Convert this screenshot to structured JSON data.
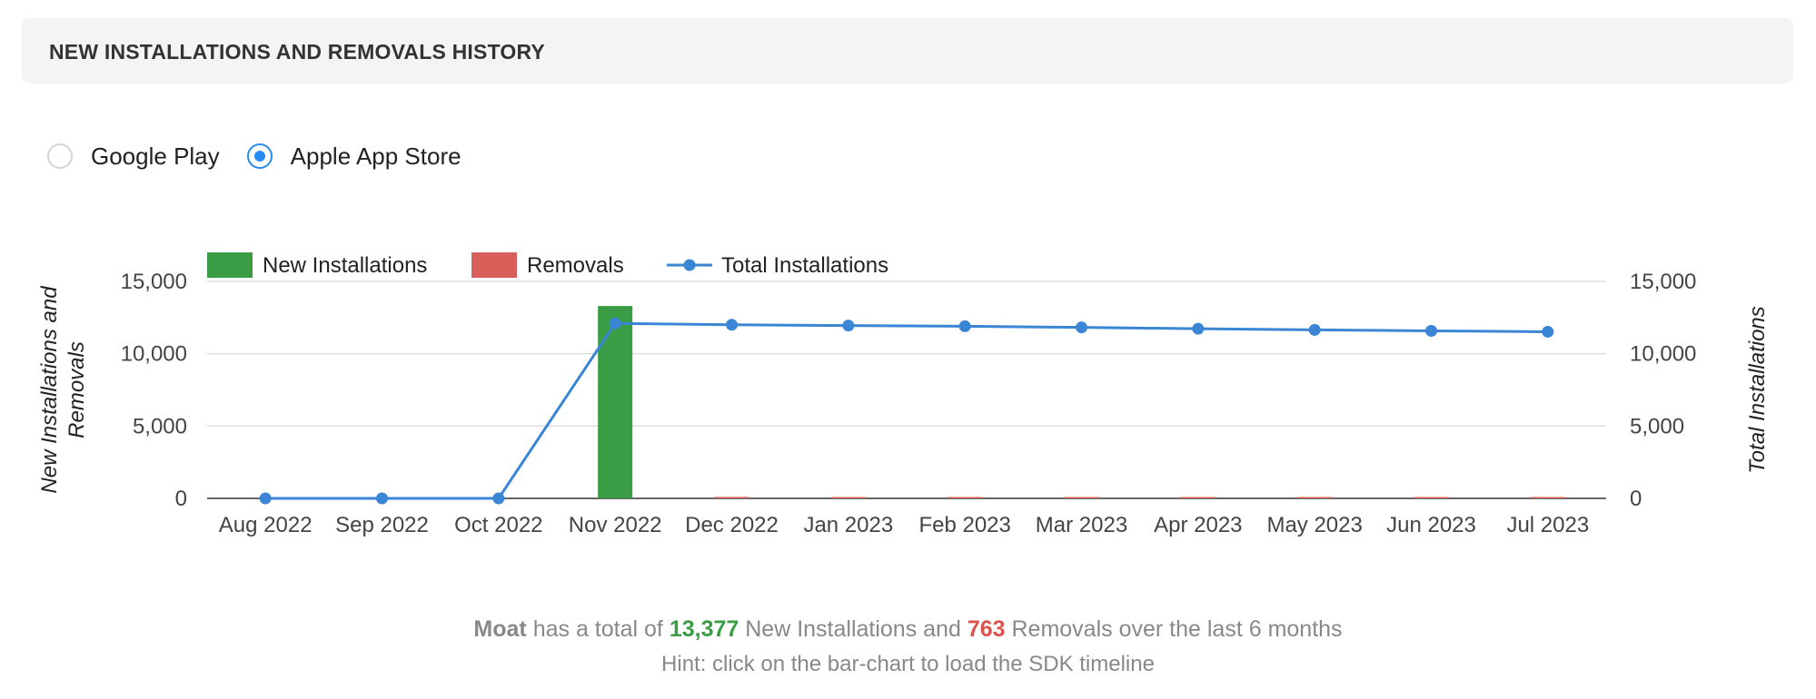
{
  "header": {
    "title": "NEW INSTALLATIONS AND REMOVALS HISTORY"
  },
  "store_selector": {
    "options": [
      {
        "label": "Google Play",
        "selected": false
      },
      {
        "label": "Apple App Store",
        "selected": true
      }
    ]
  },
  "chart_data": {
    "type": "bar",
    "categories": [
      "Aug 2022",
      "Sep 2022",
      "Oct 2022",
      "Nov 2022",
      "Dec 2022",
      "Jan 2023",
      "Feb 2023",
      "Mar 2023",
      "Apr 2023",
      "May 2023",
      "Jun 2023",
      "Jul 2023"
    ],
    "series": [
      {
        "name": "New Installations",
        "type": "bar",
        "axis": "left",
        "color": "#3a9c45",
        "values": [
          0,
          0,
          0,
          13300,
          0,
          0,
          0,
          0,
          0,
          0,
          0,
          0
        ]
      },
      {
        "name": "Removals",
        "type": "bar",
        "axis": "left",
        "color": "#d9605a",
        "values": [
          0,
          0,
          0,
          0,
          100,
          40,
          40,
          40,
          80,
          40,
          80,
          40
        ]
      },
      {
        "name": "Total Installations",
        "type": "line",
        "axis": "right",
        "color": "#3a86d4",
        "values": [
          0,
          0,
          0,
          12100,
          12000,
          11950,
          11900,
          11820,
          11730,
          11650,
          11580,
          11520
        ]
      }
    ],
    "ylabel": "New Installations and Removals",
    "ylabel_right": "Total Installations",
    "ylim": [
      0,
      15000
    ],
    "ylim_right": [
      0,
      15000
    ],
    "yticks": [
      "0",
      "5,000",
      "10,000",
      "15,000"
    ],
    "yticks_right": [
      "0",
      "5,000",
      "10,000",
      "15,000"
    ],
    "legend_position": "top-left",
    "grid": true
  },
  "summary": {
    "app_name": "Moat",
    "text_1": "has a total of",
    "new_installations": "13,377",
    "text_2": "New Installations and",
    "removals": "763",
    "text_3": "Removals over the last 6 months"
  },
  "hint": "Hint: click on the bar-chart to load the SDK timeline"
}
